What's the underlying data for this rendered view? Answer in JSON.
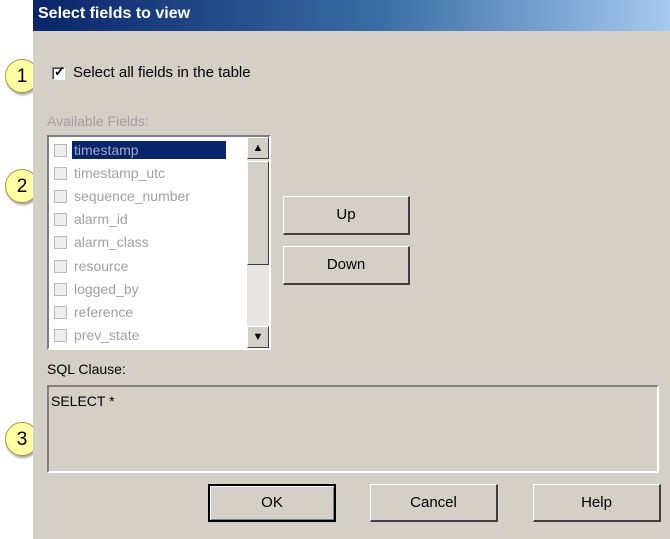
{
  "window": {
    "title": "Select fields to view"
  },
  "markers": [
    "1",
    "2",
    "3"
  ],
  "select_all": {
    "label": "Select all fields in the table",
    "checked": true
  },
  "available_fields": {
    "label": "Available Fields:",
    "items": [
      {
        "label": "timestamp",
        "selected": true
      },
      {
        "label": "timestamp_utc"
      },
      {
        "label": "sequence_number"
      },
      {
        "label": "alarm_id"
      },
      {
        "label": "alarm_class"
      },
      {
        "label": "resource"
      },
      {
        "label": "logged_by"
      },
      {
        "label": "reference"
      },
      {
        "label": "prev_state"
      }
    ]
  },
  "buttons": {
    "up": "Up",
    "down": "Down",
    "ok": "OK",
    "cancel": "Cancel",
    "help": "Help"
  },
  "sql": {
    "label": "SQL Clause:",
    "value": "SELECT *"
  }
}
